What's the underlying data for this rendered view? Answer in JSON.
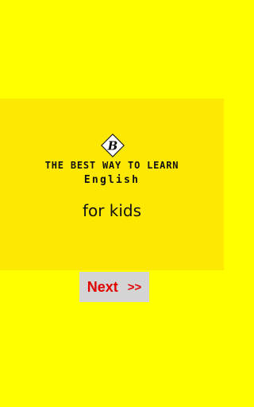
{
  "splash": {
    "logo_letter": "B",
    "tagline": "THE BEST WAY TO LEARN",
    "subject": "English",
    "audience": "for kids"
  },
  "next_button": {
    "label": "Next",
    "arrow": ">>"
  },
  "colors": {
    "background": "#ffff00",
    "banner": "#fce800",
    "button_bg": "#d4d4d4",
    "button_text": "#e00000",
    "text": "#111111"
  }
}
